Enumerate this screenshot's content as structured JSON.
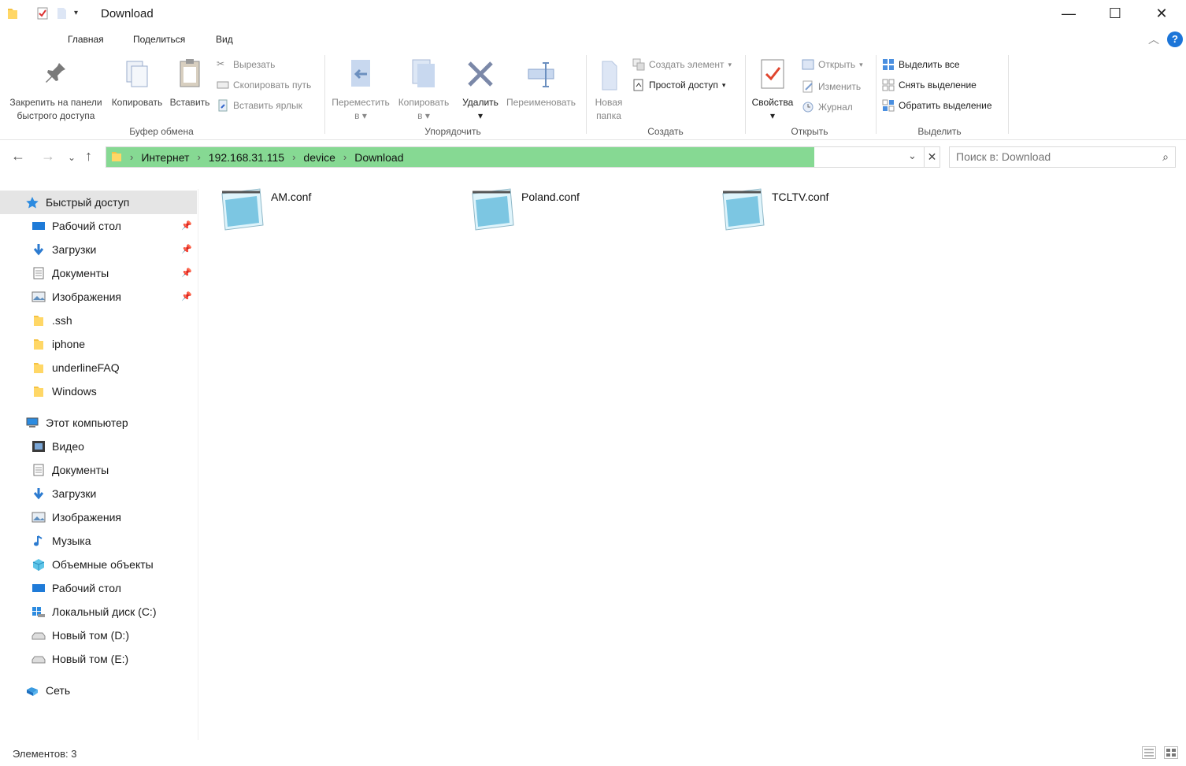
{
  "window": {
    "title": "Download",
    "controls": {
      "minimize": "—",
      "maximize": "☐",
      "close": "✕"
    }
  },
  "ribbon_tabs": [
    "Главная",
    "Поделиться",
    "Вид"
  ],
  "ribbon": {
    "clipboard": {
      "pin_label_1": "Закрепить на панели",
      "pin_label_2": "быстрого доступа",
      "copy": "Копировать",
      "paste": "Вставить",
      "cut": "Вырезать",
      "copy_path": "Скопировать путь",
      "paste_shortcut": "Вставить ярлык",
      "group": "Буфер обмена"
    },
    "organize": {
      "move_1": "Переместить",
      "move_2": "в",
      "copy_1": "Копировать",
      "copy_2": "в",
      "delete": "Удалить",
      "rename": "Переименовать",
      "group": "Упорядочить"
    },
    "new": {
      "new_folder_1": "Новая",
      "new_folder_2": "папка",
      "new_item": "Создать элемент",
      "easy_access": "Простой доступ",
      "group": "Создать"
    },
    "open": {
      "properties": "Свойства",
      "open": "Открыть",
      "edit": "Изменить",
      "history": "Журнал",
      "group": "Открыть"
    },
    "select": {
      "select_all": "Выделить все",
      "select_none": "Снять выделение",
      "invert": "Обратить выделение",
      "group": "Выделить"
    }
  },
  "address": {
    "crumbs": [
      "Интернет",
      "192.168.31.115",
      "device",
      "Download"
    ]
  },
  "search": {
    "placeholder": "Поиск в: Download"
  },
  "nav": {
    "quick_access": "Быстрый доступ",
    "quick_items": [
      {
        "label": "Рабочий стол",
        "icon": "desktop-icon",
        "pinned": true
      },
      {
        "label": "Загрузки",
        "icon": "downloads-icon",
        "pinned": true
      },
      {
        "label": "Документы",
        "icon": "documents-icon",
        "pinned": true
      },
      {
        "label": "Изображения",
        "icon": "pictures-icon",
        "pinned": true
      },
      {
        "label": ".ssh",
        "icon": "folder-icon",
        "pinned": false
      },
      {
        "label": "iphone",
        "icon": "folder-icon",
        "pinned": false
      },
      {
        "label": "underlineFAQ",
        "icon": "folder-icon",
        "pinned": false
      },
      {
        "label": "Windows",
        "icon": "folder-icon",
        "pinned": false
      }
    ],
    "this_pc": "Этот компьютер",
    "pc_items": [
      {
        "label": "Видео",
        "icon": "video-icon"
      },
      {
        "label": "Документы",
        "icon": "documents-icon"
      },
      {
        "label": "Загрузки",
        "icon": "downloads-icon"
      },
      {
        "label": "Изображения",
        "icon": "pictures-icon"
      },
      {
        "label": "Музыка",
        "icon": "music-icon"
      },
      {
        "label": "Объемные объекты",
        "icon": "3d-objects-icon"
      },
      {
        "label": "Рабочий стол",
        "icon": "desktop-icon"
      },
      {
        "label": "Локальный диск (C:)",
        "icon": "drive-c-icon"
      },
      {
        "label": "Новый том (D:)",
        "icon": "drive-icon"
      },
      {
        "label": "Новый том (E:)",
        "icon": "drive-icon"
      }
    ],
    "network": "Сеть"
  },
  "files": [
    {
      "name": "AM.conf",
      "icon": "notepad-file-icon"
    },
    {
      "name": "Poland.conf",
      "icon": "notepad-file-icon"
    },
    {
      "name": "TCLTV.conf",
      "icon": "notepad-file-icon"
    }
  ],
  "status": {
    "items": "Элементов: 3"
  },
  "colors": {
    "address_highlight": "#86d993",
    "accent": "#1c75d8",
    "selected_nav": "#e5e5e5"
  }
}
